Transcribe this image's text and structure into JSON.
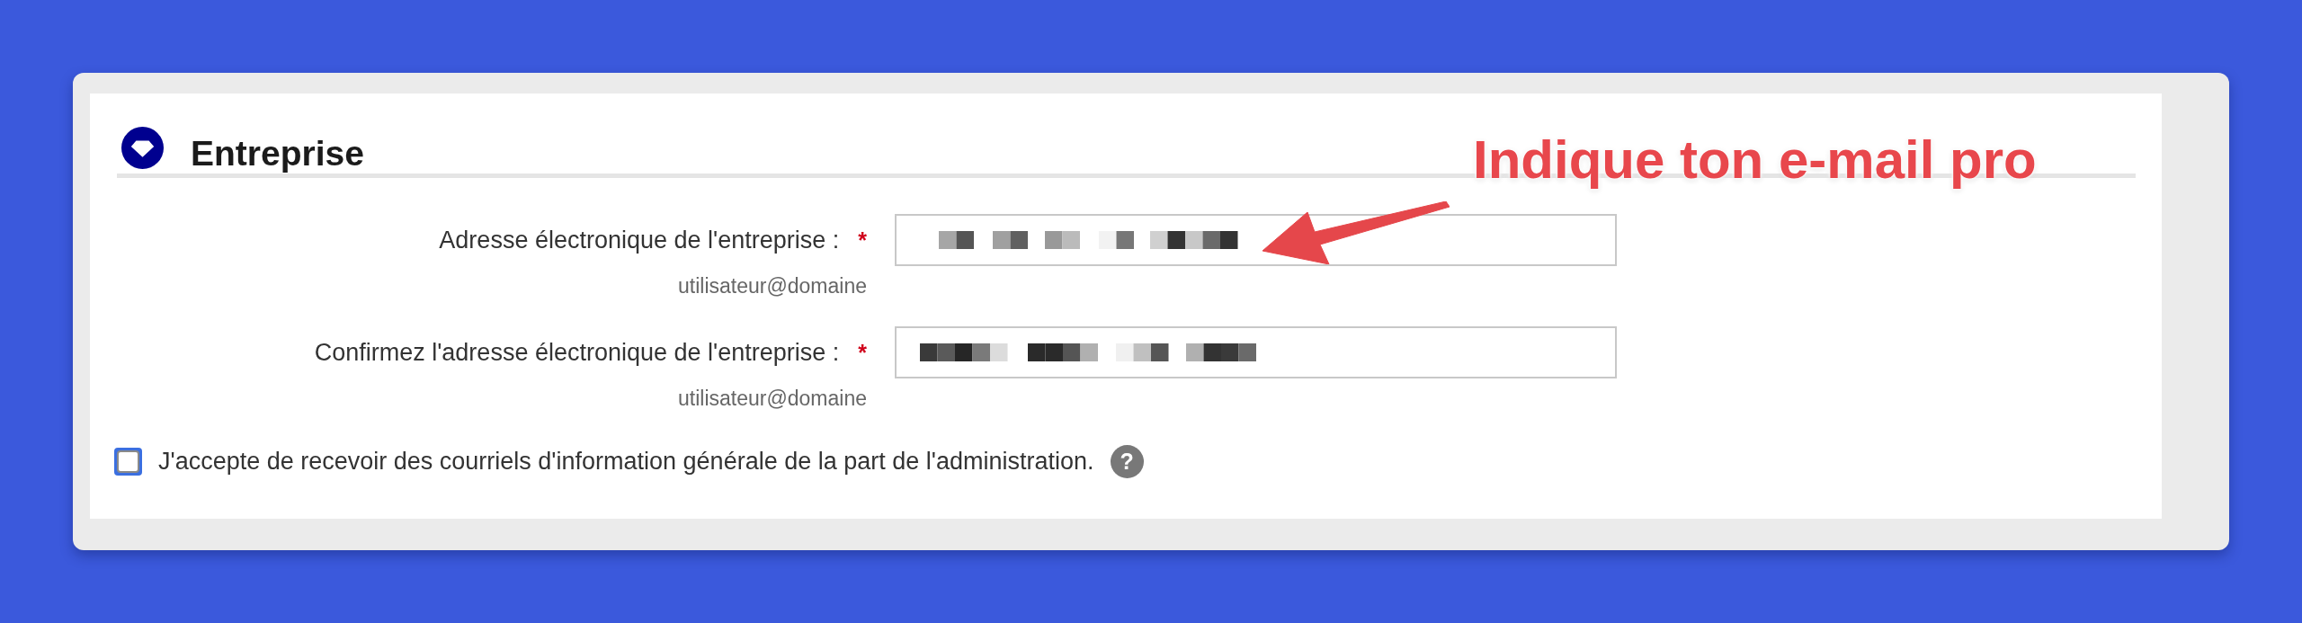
{
  "section": {
    "title": "Entreprise"
  },
  "fields": [
    {
      "label": "Adresse électronique de l'entreprise :",
      "required_mark": "*",
      "value_pixelated": true,
      "hint": "utilisateur@domaine"
    },
    {
      "label": "Confirmez l'adresse électronique de l'entreprise :",
      "required_mark": "*",
      "value_pixelated": true,
      "hint": "utilisateur@domaine"
    }
  ],
  "consent": {
    "label": "J'accepte de recevoir des courriels d'information générale de la part de l'administration.",
    "checked": false,
    "help_icon": "?"
  },
  "annotation": {
    "text": "Indique ton e-mail pro"
  }
}
